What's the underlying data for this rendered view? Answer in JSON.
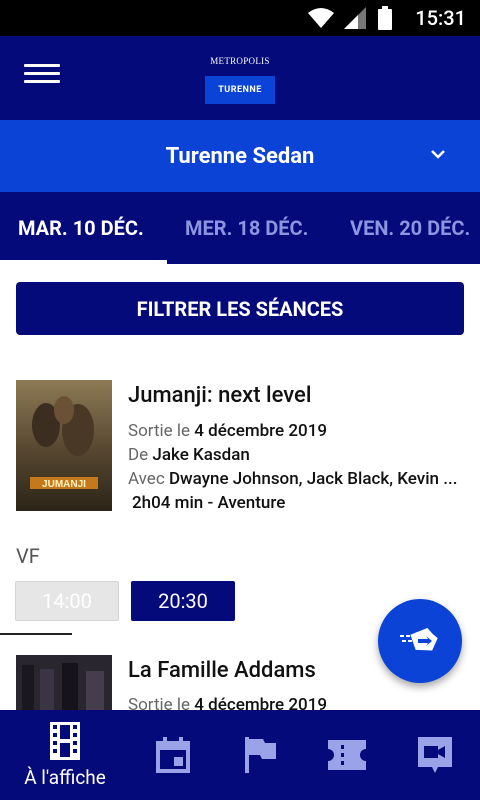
{
  "status_bar": {
    "time": "15:31"
  },
  "header": {
    "logo_top": "METROPOLIS",
    "logo_bottom": "TURENNE"
  },
  "cinema_selector": {
    "name": "Turenne Sedan"
  },
  "date_tabs": [
    {
      "label": "MAR. 10 DÉC.",
      "active": true
    },
    {
      "label": "MER. 18 DÉC.",
      "active": false
    },
    {
      "label": "VEN. 20 DÉC.",
      "active": false
    }
  ],
  "filter_button": {
    "label": "FILTRER LES SÉANCES"
  },
  "movies": [
    {
      "title": "Jumanji: next level",
      "release_prefix": "Sortie le",
      "release_date": "4 décembre 2019",
      "director_prefix": "De",
      "director": "Jake Kasdan",
      "cast_prefix": "Avec",
      "cast": "Dwayne Johnson, Jack Black, Kevin ...",
      "duration_genre": "2h04 min - Aventure",
      "poster_text": "JUMANJI",
      "version": "VF",
      "showtimes": [
        "14:00",
        "20:30"
      ]
    },
    {
      "title": "La Famille Addams",
      "release_prefix": "Sortie le",
      "release_date": "4 décembre 2019"
    }
  ],
  "bottom_nav": {
    "items": [
      {
        "label": "À l'affiche",
        "icon": "film-icon",
        "active": true
      },
      {
        "icon": "calendar-icon"
      },
      {
        "icon": "flag-icon"
      },
      {
        "icon": "ticket-icon"
      },
      {
        "icon": "video-icon"
      }
    ]
  },
  "colors": {
    "primary_dark": "#050a7a",
    "primary": "#0b43d6",
    "inactive_tab": "#8c96e0"
  }
}
